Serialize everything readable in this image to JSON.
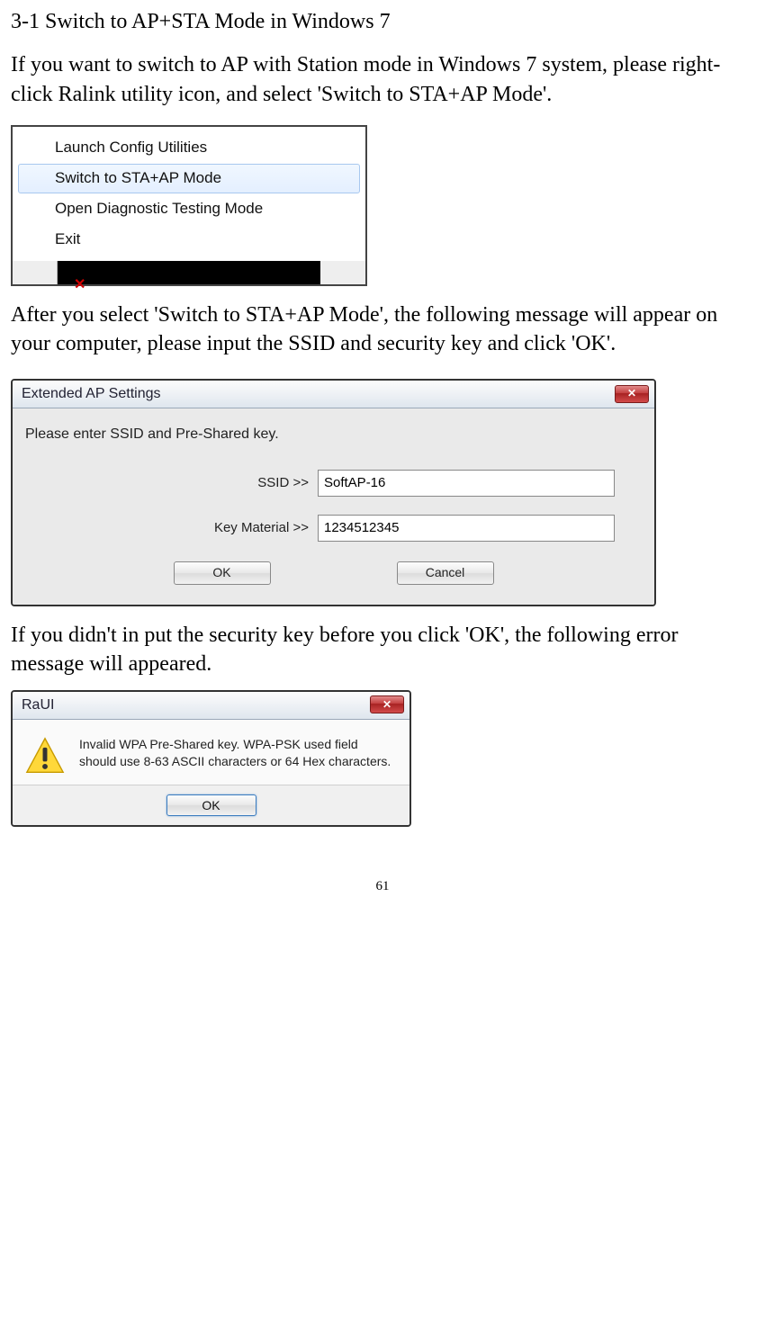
{
  "heading": "3-1 Switch to AP+STA Mode in Windows 7",
  "intro_para": "If you want to switch to AP with Station mode in Windows 7 system, please right-click Ralink utility icon, and select 'Switch to STA+AP Mode'.",
  "context_menu": {
    "items": [
      "Launch Config Utilities",
      "Switch to STA+AP Mode",
      "Open Diagnostic Testing Mode",
      "Exit"
    ],
    "selected_index": 1
  },
  "mid_para": "After you select 'Switch to STA+AP Mode', the following message will appear on your computer, please input the SSID and security key and click 'OK'.",
  "dialog1": {
    "title": "Extended AP Settings",
    "instruction": "Please enter SSID and Pre-Shared key.",
    "ssid_label": "SSID >>",
    "ssid_value": "SoftAP-16",
    "key_label": "Key Material >>",
    "key_value": "1234512345",
    "ok_label": "OK",
    "cancel_label": "Cancel"
  },
  "after_dialog_para": "If you didn't in put the security key before you click 'OK', the following error message will appeared.",
  "dialog2": {
    "title": "RaUI",
    "message": "Invalid WPA Pre-Shared key. WPA-PSK used field should use 8-63 ASCII characters or 64 Hex characters.",
    "ok_label": "OK"
  },
  "page_number": "61"
}
